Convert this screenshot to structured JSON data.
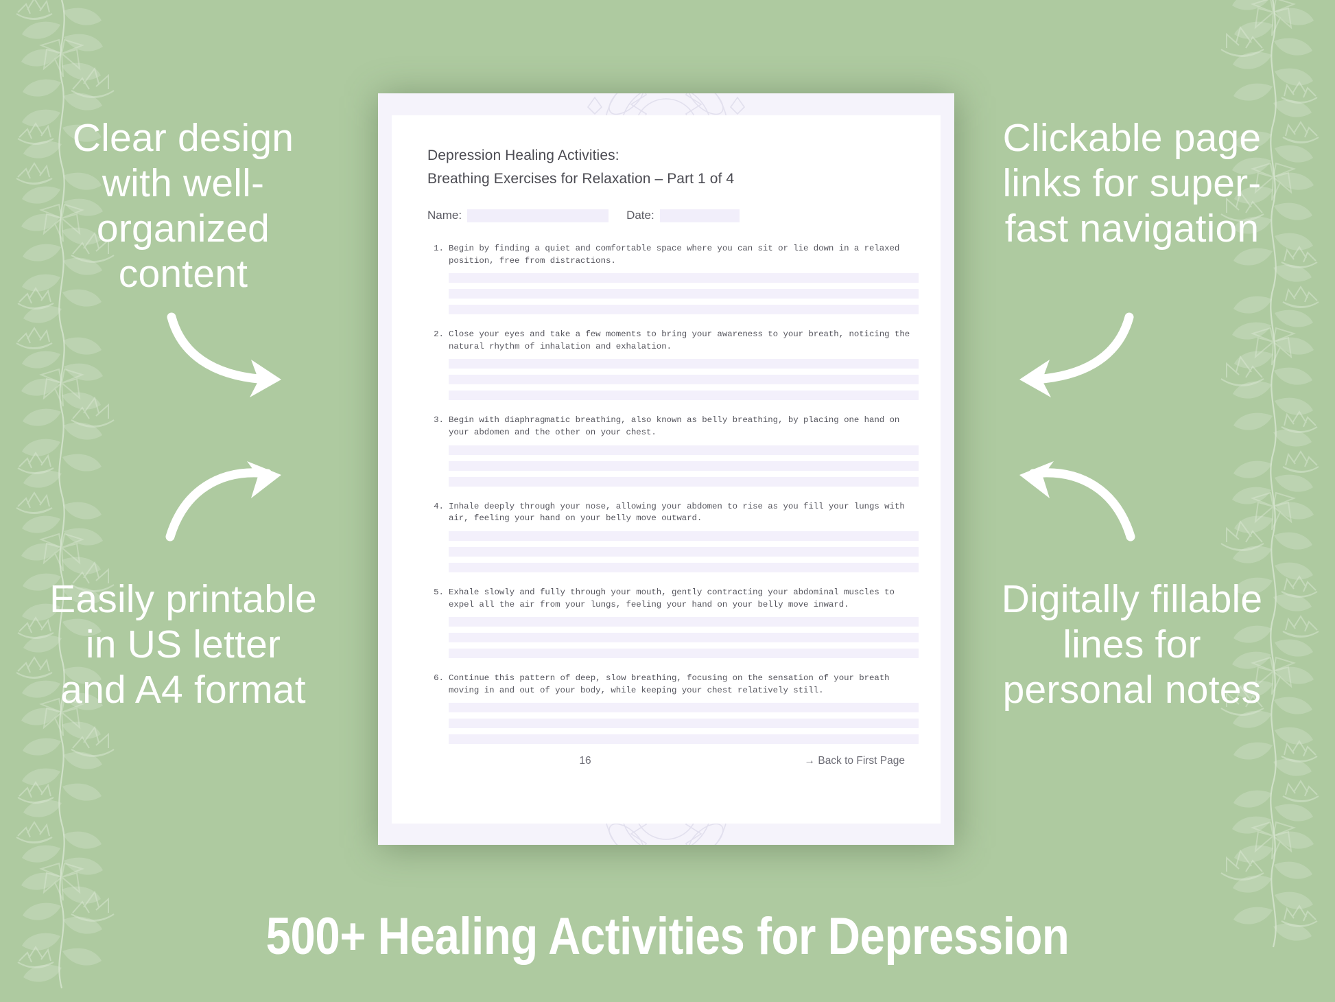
{
  "theme": {
    "background_color": "#aecaa0",
    "text_color": "#ffffff",
    "document_frame_color": "#f5f3fb",
    "document_page_color": "#ffffff",
    "fill_line_color": "#f3f0fb",
    "body_text_color": "#55555d"
  },
  "promos": {
    "top_left": "Clear design with well-organized content",
    "bottom_left": "Easily printable in US letter and A4 format",
    "top_right": "Clickable page links for super-fast navigation",
    "bottom_right": "Digitally fillable lines for personal notes"
  },
  "document": {
    "title_line1": "Depression Healing Activities:",
    "title_line2": "Breathing Exercises for Relaxation – Part 1 of 4",
    "name_label": "Name:",
    "date_label": "Date:",
    "name_value": "",
    "date_value": "",
    "tasks": [
      {
        "number": "1.",
        "text": "Begin by finding a quiet and comfortable space where you can sit or lie down in a relaxed position, free from distractions.",
        "line_count": 3
      },
      {
        "number": "2.",
        "text": "Close your eyes and take a few moments to bring your awareness to your breath, noticing the natural rhythm of inhalation and exhalation.",
        "line_count": 3
      },
      {
        "number": "3.",
        "text": "Begin with diaphragmatic breathing, also known as belly breathing, by placing one hand on your abdomen and the other on your chest.",
        "line_count": 3
      },
      {
        "number": "4.",
        "text": "Inhale deeply through your nose, allowing your abdomen to rise as you fill your lungs with air, feeling your hand on your belly move outward.",
        "line_count": 3
      },
      {
        "number": "5.",
        "text": "Exhale slowly and fully through your mouth, gently contracting your abdominal muscles to expel all the air from your lungs, feeling your hand on your belly move inward.",
        "line_count": 3
      },
      {
        "number": "6.",
        "text": "Continue this pattern of deep, slow breathing, focusing on the sensation of your breath moving in and out of your body, while keeping your chest relatively still.",
        "line_count": 3
      }
    ],
    "page_number": "16",
    "back_link": "→ Back to First Page"
  },
  "banner": {
    "headline": "500+ Healing Activities for Depression"
  }
}
